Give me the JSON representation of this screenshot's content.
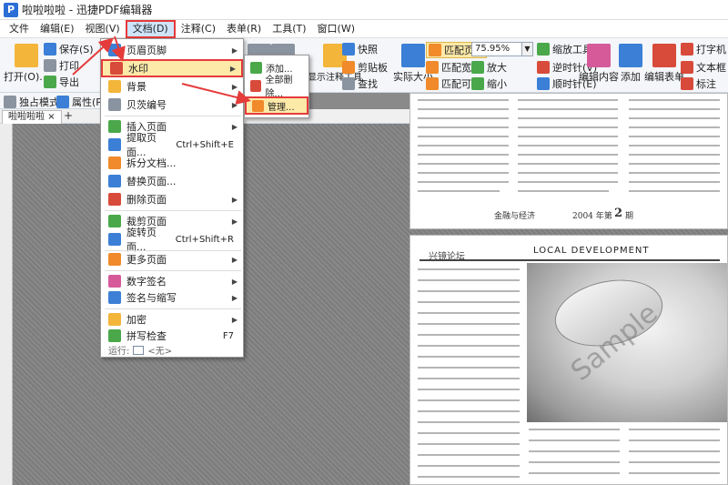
{
  "window": {
    "title": "啦啦啦啦 - 迅捷PDF编辑器",
    "app_icon": "P"
  },
  "menubar": [
    "文件",
    "编辑(E)",
    "视图(V)",
    "文档(D)",
    "注释(C)",
    "表单(R)",
    "工具(T)",
    "窗口(W)"
  ],
  "ribbon": {
    "open": "打开(O)...",
    "save": "保存(S)",
    "print": "打印",
    "export": "导出",
    "select_mode": "独占模式",
    "properties": "属性(P)...",
    "snapshot": "快照",
    "clipboard": "剪贴板",
    "search": "查找",
    "show_comment_tools": "显示注释工具",
    "actual_size": "实际大小",
    "fit_page": "匹配页面",
    "fit_width": "匹配宽度",
    "fit_visible": "匹配可见",
    "zoom_value": "75.95%",
    "zoom_in": "放大",
    "zoom_out": "缩小",
    "zoom_tool": "缩放工具",
    "rotate_ccw": "逆时针(V)",
    "rotate_cw": "顺时针(E)",
    "edit_content": "编辑内容",
    "add": "添加",
    "edit_form": "编辑表单",
    "typewriter": "打字机",
    "textbox": "文本框",
    "annotation": "标注"
  },
  "tab": {
    "name": "啦啦啦啦",
    "close": "×",
    "new": "+"
  },
  "doc_menu": {
    "items": [
      {
        "label": "页眉页脚",
        "shortcut": "",
        "arrow": true
      },
      {
        "label": "水印",
        "shortcut": "",
        "arrow": true
      },
      {
        "label": "背景",
        "shortcut": "",
        "arrow": true
      },
      {
        "label": "贝茨编号",
        "shortcut": "",
        "arrow": true
      },
      {
        "label": "插入页面",
        "shortcut": "",
        "arrow": true
      },
      {
        "label": "提取页面...",
        "shortcut": "Ctrl+Shift+E",
        "arrow": false
      },
      {
        "label": "拆分文档...",
        "shortcut": "",
        "arrow": false
      },
      {
        "label": "替换页面...",
        "shortcut": "",
        "arrow": false
      },
      {
        "label": "删除页面",
        "shortcut": "",
        "arrow": true
      },
      {
        "label": "裁剪页面",
        "shortcut": "",
        "arrow": true
      },
      {
        "label": "旋转页面...",
        "shortcut": "Ctrl+Shift+R",
        "arrow": false
      },
      {
        "label": "更多页面",
        "shortcut": "",
        "arrow": true
      },
      {
        "label": "数字签名",
        "shortcut": "",
        "arrow": true
      },
      {
        "label": "签名与缩写",
        "shortcut": "",
        "arrow": true
      },
      {
        "label": "加密",
        "shortcut": "",
        "arrow": true
      },
      {
        "label": "拼写检查",
        "shortcut": "F7",
        "arrow": false
      }
    ],
    "run_label": "运行:",
    "run_value": "<无>"
  },
  "watermark_submenu": {
    "items": [
      "添加...",
      "全部删除...",
      "管理..."
    ]
  },
  "page1": {
    "footer_left": "金融与经济",
    "footer_date": "2004 年第",
    "footer_num": "2",
    "footer_suffix": "期"
  },
  "page2": {
    "header_left": "兴镜论坛",
    "header_right": "LOCAL DEVELOPMENT"
  },
  "watermark_text": "Sample",
  "colors": {
    "highlight": "#fde9a8",
    "callout": "#e43b3b",
    "menu_active": "#cfe4fb"
  }
}
